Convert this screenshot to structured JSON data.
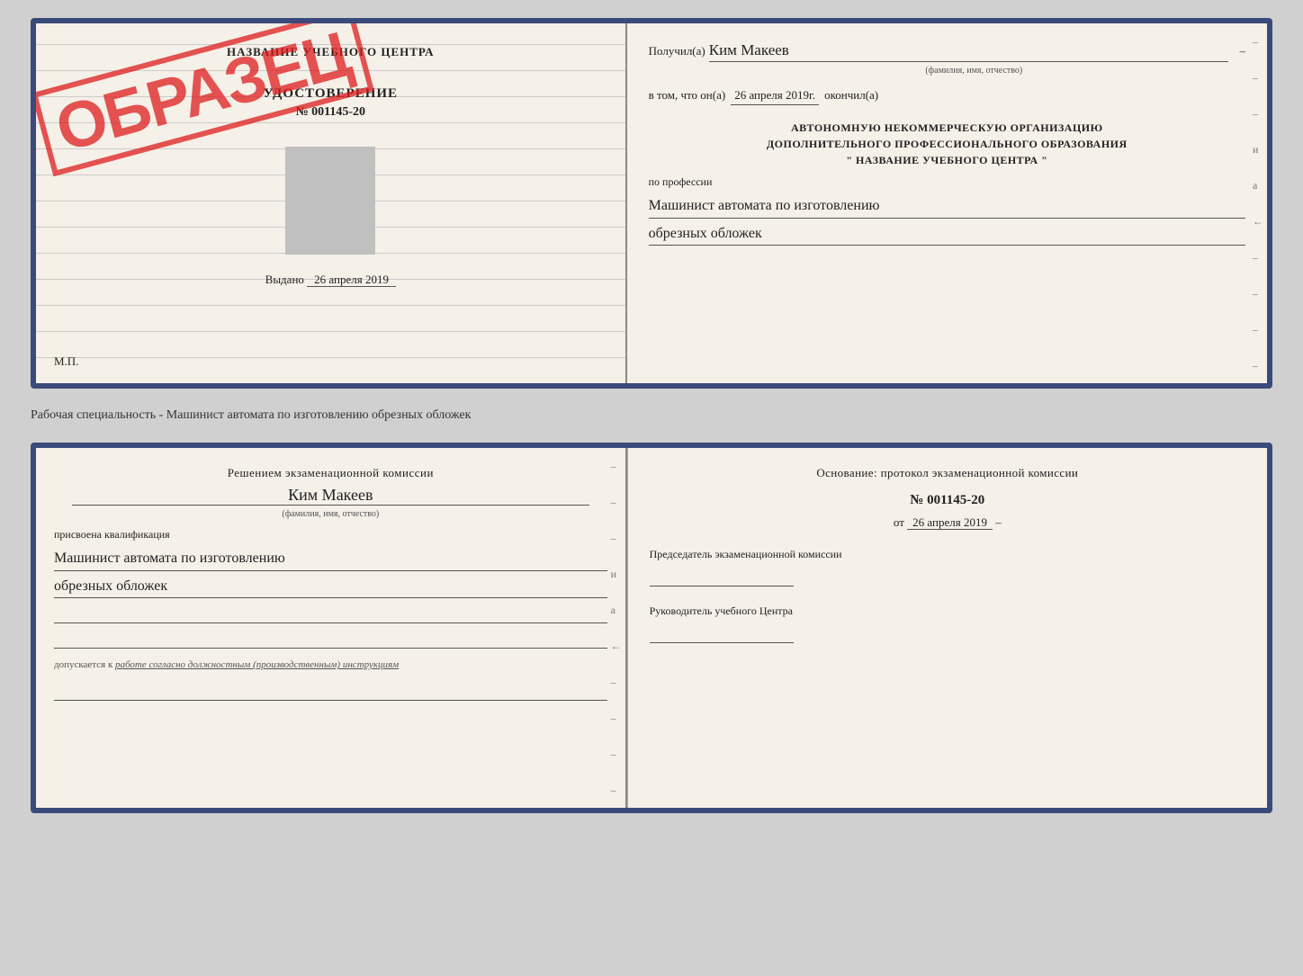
{
  "top_doc": {
    "left": {
      "school_title": "НАЗВАНИЕ УЧЕБНОГО ЦЕНТРА",
      "certificate_label": "УДОСТОВЕРЕНИЕ",
      "certificate_number": "№ 001145-20",
      "issued_label": "Выдано",
      "issued_date": "26 апреля 2019",
      "mp_label": "М.П.",
      "stamp_text": "ОБРАЗЕЦ"
    },
    "right": {
      "recipient_prefix": "Получил(а)",
      "recipient_name": "Ким Макеев",
      "recipient_sublabel": "(фамилия, имя, отчество)",
      "vtom_prefix": "в том, что он(а)",
      "vtom_date": "26 апреля 2019г.",
      "vtom_suffix": "окончил(а)",
      "org_line1": "АВТОНОМНУЮ НЕКОММЕРЧЕСКУЮ ОРГАНИЗАЦИЮ",
      "org_line2": "ДОПОЛНИТЕЛЬНОГО ПРОФЕССИОНАЛЬНОГО ОБРАЗОВАНИЯ",
      "org_line3": "\"  НАЗВАНИЕ УЧЕБНОГО ЦЕНТРА  \"",
      "profession_label": "по профессии",
      "profession_line1": "Машинист автомата по изготовлению",
      "profession_line2": "обрезных обложек"
    }
  },
  "separator": {
    "text": "Рабочая специальность - Машинист автомата по изготовлению обрезных обложек"
  },
  "bottom_doc": {
    "left": {
      "decision_text": "Решением экзаменационной комиссии",
      "person_name": "Ким Макеев",
      "person_sublabel": "(фамилия, имя, отчество)",
      "qualification_label": "присвоена квалификация",
      "qualification_line1": "Машинист автомата по изготовлению",
      "qualification_line2": "обрезных обложек",
      "допуск_prefix": "допускается к",
      "допуск_italic": "работе согласно должностным (производственным) инструкциям"
    },
    "right": {
      "osnov_text": "Основание: протокол экзаменационной комиссии",
      "protocol_number": "№ 001145-20",
      "protocol_date_prefix": "от",
      "protocol_date": "26 апреля 2019",
      "chairman_label": "Председатель экзаменационной комиссии",
      "director_label": "Руководитель учебного Центра"
    }
  }
}
